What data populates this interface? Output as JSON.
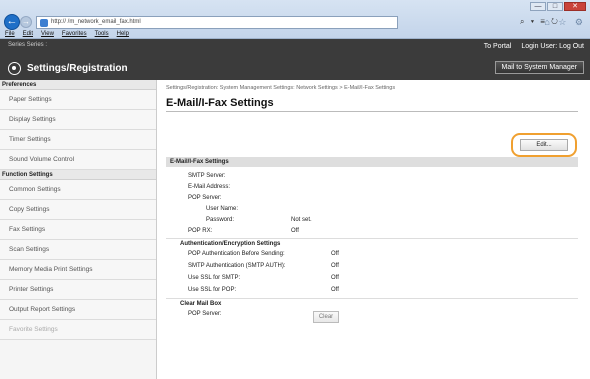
{
  "browser": {
    "url": "http://                   /m_network_email_fax.html",
    "menu": [
      "File",
      "Edit",
      "View",
      "Favorites",
      "Tools",
      "Help"
    ],
    "window_controls": [
      "—",
      "□",
      "✕"
    ],
    "addr_tools": "⌕ ▾ ≡ ↻",
    "toolbar_icons": "⌂ ☆ ⚙"
  },
  "header": {
    "device_line": "         Series           Series :",
    "to_portal": "To Portal",
    "login_user": "Login User:            Log Out",
    "title": "Settings/Registration",
    "mail_button": "Mail to System Manager"
  },
  "sidebar": {
    "sections": [
      {
        "title": "Preferences",
        "items": [
          "Paper Settings",
          "Display Settings",
          "Timer Settings",
          "Sound Volume Control"
        ]
      },
      {
        "title": "Function Settings",
        "items": [
          "Common Settings",
          "Copy Settings",
          "Fax Settings",
          "Scan Settings",
          "Memory Media Print Settings",
          "Printer Settings",
          "Output Report Settings",
          "Favorite Settings"
        ]
      }
    ]
  },
  "main": {
    "breadcrumb": "Settings/Registration: System Management Settings: Network Settings > E-Mail/I-Fax Settings",
    "title": "E-Mail/I-Fax Settings",
    "edit_button": "Edit...",
    "section_title": "E-Mail/I-Fax Settings",
    "rows": [
      {
        "label": "SMTP Server:",
        "value": ""
      },
      {
        "label": "E-Mail Address:",
        "value": ""
      },
      {
        "label": "POP Server:",
        "value": ""
      },
      {
        "label": "User Name:",
        "value": ""
      },
      {
        "label": "Password:",
        "value": "Not set."
      },
      {
        "label": "POP RX:",
        "value": "Off"
      }
    ],
    "auth_title": "Authentication/Encryption Settings",
    "auth_rows": [
      {
        "label": "POP Authentication Before Sending:",
        "value": "Off"
      },
      {
        "label": "SMTP Authentication (SMTP AUTH):",
        "value": "Off"
      },
      {
        "label": "Use SSL for SMTP:",
        "value": "Off"
      },
      {
        "label": "Use SSL for POP:",
        "value": "Off"
      }
    ],
    "clear_title": "Clear Mail Box",
    "clear_row_label": "POP Server:",
    "clear_button": "Clear"
  }
}
